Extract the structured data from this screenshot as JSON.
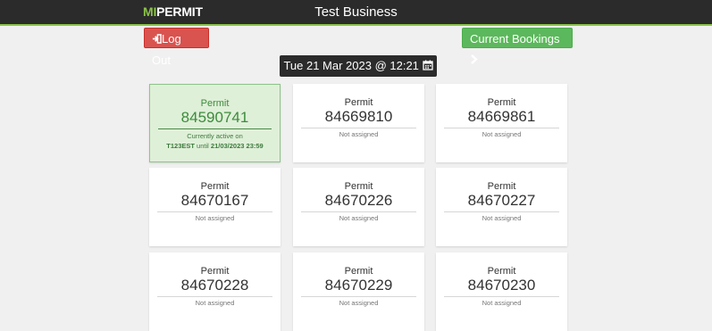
{
  "header": {
    "logo_mi": "MI",
    "logo_permit": "PERMIT",
    "title": "Test Business"
  },
  "toolbar": {
    "logout_label": "Log Out",
    "bookings_label": "Current Bookings"
  },
  "datetime": "Tue 21 Mar 2023 @ 12:21",
  "permits": [
    {
      "label": "Permit",
      "number": "84590741",
      "active": true,
      "status_prefix": "Currently active on",
      "vrm": "T123EST",
      "until_word": "until",
      "until": "21/03/2023 23:59"
    },
    {
      "label": "Permit",
      "number": "84669810",
      "active": false,
      "status": "Not assigned"
    },
    {
      "label": "Permit",
      "number": "84669861",
      "active": false,
      "status": "Not assigned"
    },
    {
      "label": "Permit",
      "number": "84670167",
      "active": false,
      "status": "Not assigned"
    },
    {
      "label": "Permit",
      "number": "84670226",
      "active": false,
      "status": "Not assigned"
    },
    {
      "label": "Permit",
      "number": "84670227",
      "active": false,
      "status": "Not assigned"
    },
    {
      "label": "Permit",
      "number": "84670228",
      "active": false,
      "status": "Not assigned"
    },
    {
      "label": "Permit",
      "number": "84670229",
      "active": false,
      "status": "Not assigned"
    },
    {
      "label": "Permit",
      "number": "84670230",
      "active": false,
      "status": "Not assigned"
    }
  ],
  "colors": {
    "brand_green": "#8bc34a",
    "header_bg": "#2b2b2b",
    "danger": "#d9534f",
    "success": "#5cb85c",
    "active_card_bg": "#dff0d8"
  },
  "icons": {
    "logout": "sign-out-icon",
    "bookings": "chevron-right-icon",
    "date": "calendar-icon"
  }
}
